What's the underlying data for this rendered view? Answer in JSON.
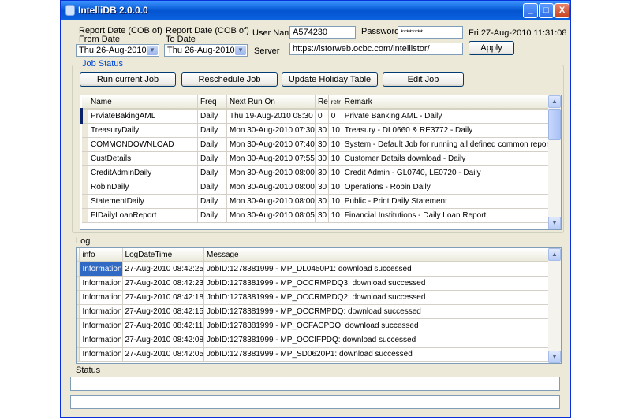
{
  "window": {
    "title": "IntelliDB 2.0.0.0",
    "minimize": "_",
    "maximize": "□",
    "close": "X"
  },
  "filters": {
    "from_label_1": "Report Date (COB of)",
    "from_label_2": "From Date",
    "to_label_1": "Report Date (COB of)",
    "to_label_2": "To Date",
    "from_value": "Thu  26-Aug-2010",
    "to_value": "Thu  26-Aug-2010",
    "username_label": "User Name",
    "username_value": "A574230",
    "password_label": "Password",
    "password_value": "********",
    "datetime": "Fri 27-Aug-2010 11:31:08",
    "server_label": "Server",
    "server_value": "https://istorweb.ocbc.com/intellistor/",
    "apply_label": "Apply"
  },
  "job_status": {
    "legend": "Job Status",
    "buttons": {
      "run": "Run current Job",
      "reschedule": "Reschedule Job",
      "holiday": "Update Holiday Table",
      "edit": "Edit Job"
    },
    "columns": [
      "Name",
      "Freq",
      "Next Run On",
      "Re",
      "retr",
      "Remark"
    ],
    "rows": [
      [
        "PrviateBakingAML",
        "Daily",
        "Thu 19-Aug-2010 08:30",
        "0",
        "0",
        "Private Banking AML - Daily"
      ],
      [
        "TreasuryDaily",
        "Daily",
        "Mon 30-Aug-2010 07:30",
        "30",
        "10",
        "Treasury - DL0660 & RE3772 - Daily"
      ],
      [
        "COMMONDOWNLOAD",
        "Daily",
        "Mon 30-Aug-2010 07:40",
        "30",
        "10",
        "System - Default Job for running all defined common report"
      ],
      [
        "CustDetails",
        "Daily",
        "Mon 30-Aug-2010 07:55",
        "30",
        "10",
        "Customer Details download - Daily"
      ],
      [
        "CreditAdminDaily",
        "Daily",
        "Mon 30-Aug-2010 08:00",
        "30",
        "10",
        "Credit Admin - GL0740, LE0720 - Daily"
      ],
      [
        "RobinDaily",
        "Daily",
        "Mon 30-Aug-2010 08:00",
        "30",
        "10",
        "Operations - Robin Daily"
      ],
      [
        "StatementDaily",
        "Daily",
        "Mon 30-Aug-2010 08:00",
        "30",
        "10",
        "Public - Print Daily Statement"
      ],
      [
        "FIDailyLoanReport",
        "Daily",
        "Mon 30-Aug-2010 08:05",
        "30",
        "10",
        "Financial Institutions - Daily Loan Report"
      ]
    ]
  },
  "log": {
    "label": "Log",
    "columns": [
      "info",
      "LogDateTime",
      "Message"
    ],
    "rows": [
      [
        "Information",
        "27-Aug-2010 08:42:25",
        "JobID:1278381999 - MP_DL0450P1: download successed"
      ],
      [
        "Information",
        "27-Aug-2010 08:42:23",
        "JobID:1278381999 - MP_OCCRMPDQ3: download successed"
      ],
      [
        "Information",
        "27-Aug-2010 08:42:18",
        "JobID:1278381999 - MP_OCCRMPDQ2: download successed"
      ],
      [
        "Information",
        "27-Aug-2010 08:42:15",
        "JobID:1278381999 - MP_OCCRMPDQ: download successed"
      ],
      [
        "Information",
        "27-Aug-2010 08:42:11",
        "JobID:1278381999 - MP_OCFACPDQ: download successed"
      ],
      [
        "Information",
        "27-Aug-2010 08:42:08",
        "JobID:1278381999 - MP_OCCIFPDQ: download successed"
      ],
      [
        "Information",
        "27-Aug-2010 08:42:05",
        "JobID:1278381999 - MP_SD0620P1: download successed"
      ]
    ]
  },
  "status": {
    "label": "Status"
  },
  "icons": {
    "dropdown": "chevron-down-icon",
    "scroll_up": "arrow-up-icon",
    "scroll_down": "arrow-down-icon",
    "app": "database-icon"
  }
}
